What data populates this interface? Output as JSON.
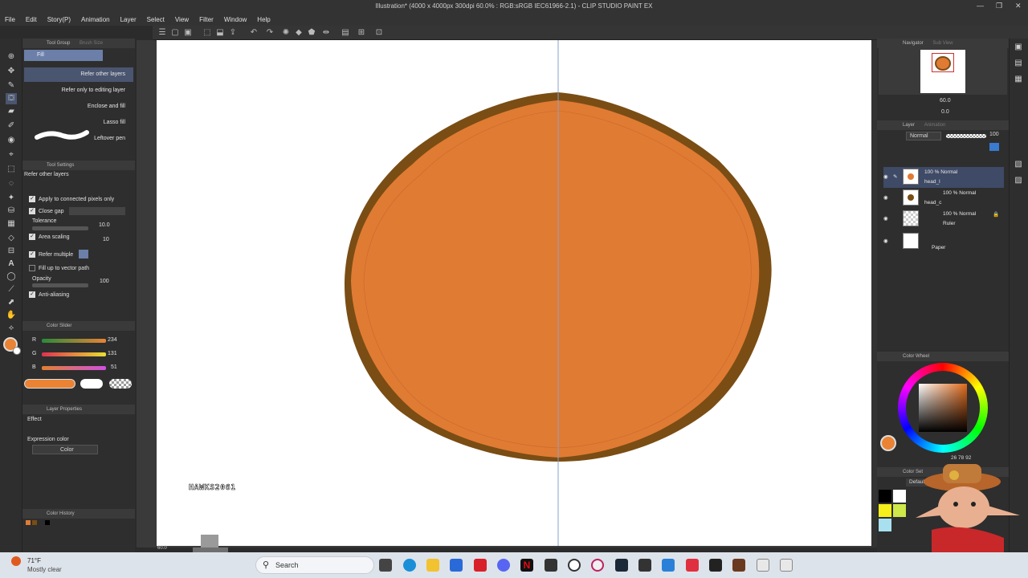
{
  "app": {
    "title": "Illustration* (4000 x 4000px 300dpi 60.0% : RGB:sRGB IEC61966-2.1) - CLIP STUDIO PAINT EX"
  },
  "menu": [
    "File",
    "Edit",
    "Story(P)",
    "Animation",
    "Layer",
    "Select",
    "View",
    "Filter",
    "Window",
    "Help"
  ],
  "tool_group": {
    "tab1": "Tool Group",
    "tab2": "Brush Size",
    "current": "Fill",
    "subtools": [
      "Refer other layers",
      "Refer only to editing layer",
      "Enclose and fill",
      "Lasso fill",
      "Leftover pen"
    ]
  },
  "tool_settings": {
    "header": "Tool Settings",
    "subtool_name": "Refer other layers",
    "apply_connected": "Apply to connected pixels only",
    "close_gap": "Close gap",
    "tolerance_label": "Tolerance",
    "tolerance_value": "10.0",
    "area_scaling_label": "Area scaling",
    "area_scaling_value": "10",
    "refer_multiple": "Refer multiple",
    "fill_vector": "Fill up to vector path",
    "opacity_label": "Opacity",
    "opacity_value": "100",
    "antialias": "Anti-aliasing"
  },
  "brush_size_badge": "100",
  "color_slider": {
    "header": "Color Slider",
    "r_label": "R",
    "r_value": "234",
    "g_label": "G",
    "g_value": "131",
    "b_label": "B",
    "b_value": "51"
  },
  "layer_properties": {
    "header": "Layer Properties",
    "effect_label": "Effect",
    "expression_label": "Expression color",
    "expression_value": "Color"
  },
  "color_history": {
    "header": "Color History"
  },
  "watermark": "HAWKS2061",
  "canvas_zoom": "60.0",
  "navigator": {
    "tab1": "Navigator",
    "tab2": "Sub View",
    "zoom": "60.0",
    "rotation": "0.0"
  },
  "layer_panel": {
    "tab1": "Layer",
    "tab2": "Animation",
    "blend_mode": "Normal",
    "opacity": "100",
    "layers": [
      {
        "info": "100 % Normal",
        "name": "head_l"
      },
      {
        "info": "100 % Normal",
        "name": "head_c"
      },
      {
        "info": "100 % Normal",
        "name": "Ruler"
      },
      {
        "info": "",
        "name": "Paper"
      }
    ]
  },
  "color_wheel": {
    "header": "Color Wheel",
    "h": "26",
    "s": "78",
    "v": "92"
  },
  "color_set": {
    "header": "Color Set",
    "palette": "Default color set"
  },
  "colors": {
    "fill": "#e07b34",
    "outline": "#7a4d14",
    "primary": "#ea8333"
  },
  "taskbar": {
    "temp": "71°F",
    "weather": "Mostly clear",
    "search": "Search"
  }
}
